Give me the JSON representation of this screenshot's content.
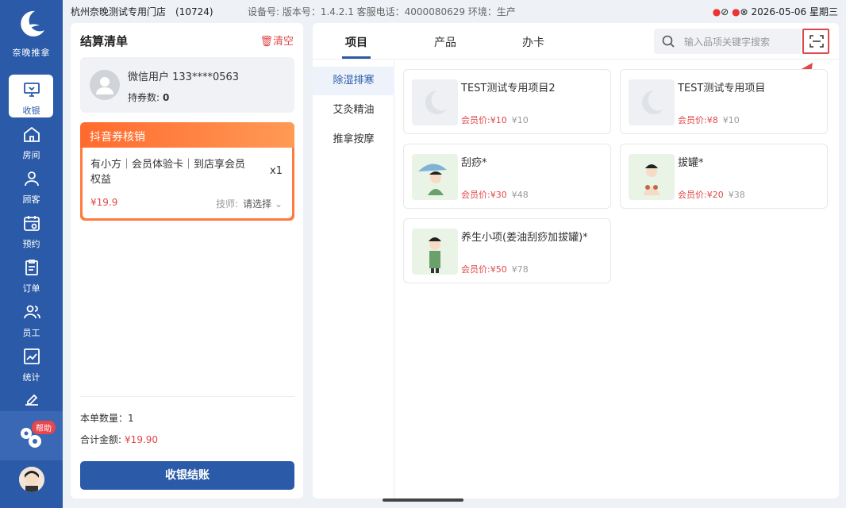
{
  "statusbar": {
    "store": "杭州奈晚测试专用门店　(10724)",
    "meta": "设备号:  版本号：1.4.2.1  客服电话：4000080629  环境：生产",
    "clock": "2026-05-06 星期三"
  },
  "sidebar": {
    "logo_text": "奈晚推拿",
    "items": [
      {
        "label": "收银",
        "icon": "cashier-icon"
      },
      {
        "label": "房间",
        "icon": "home-icon"
      },
      {
        "label": "顾客",
        "icon": "user-icon"
      },
      {
        "label": "预约",
        "icon": "calendar-icon"
      },
      {
        "label": "订单",
        "icon": "clipboard-icon"
      },
      {
        "label": "员工",
        "icon": "staff-icon"
      },
      {
        "label": "统计",
        "icon": "chart-icon"
      },
      {
        "label": "",
        "icon": "settings-icon"
      }
    ],
    "help_label": "帮助"
  },
  "checkout": {
    "title": "结算清单",
    "clear_label": "清空",
    "member_name": "微信用户 133****0563",
    "coupons_label": "持券数:",
    "coupons_count": "0",
    "coupon_header": "抖音券核销",
    "coupon_desc": "有小方｜会员体验卡｜到店享会员权益",
    "coupon_qty": "x1",
    "coupon_price": "¥19.9",
    "tech_label": "技师:",
    "tech_select": "请选择",
    "qty_label": "本单数量：1",
    "total_label": "合计金额:",
    "total_amount": "¥19.90",
    "checkout_button": "收银结账"
  },
  "catalog": {
    "tabs": [
      "项目",
      "产品",
      "办卡"
    ],
    "search_placeholder": "输入品项关键字搜索",
    "categories": [
      "除湿排寒",
      "艾灸精油",
      "推拿按摩"
    ],
    "items": [
      {
        "name": "TEST测试专用项目2",
        "member_price": "会员价:¥10",
        "orig_price": "¥10"
      },
      {
        "name": "TEST测试专用项目",
        "member_price": "会员价:¥8",
        "orig_price": "¥10"
      },
      {
        "name": "刮痧*",
        "member_price": "会员价:¥30",
        "orig_price": "¥48"
      },
      {
        "name": "拔罐*",
        "member_price": "会员价:¥20",
        "orig_price": "¥38"
      },
      {
        "name": "养生小项(姜油刮痧加拔罐)*",
        "member_price": "会员价:¥50",
        "orig_price": "¥78"
      }
    ]
  },
  "colors": {
    "primary": "#2a5aa8",
    "accent_red": "#e04848",
    "coupon_orange": "#ff7a3d"
  }
}
